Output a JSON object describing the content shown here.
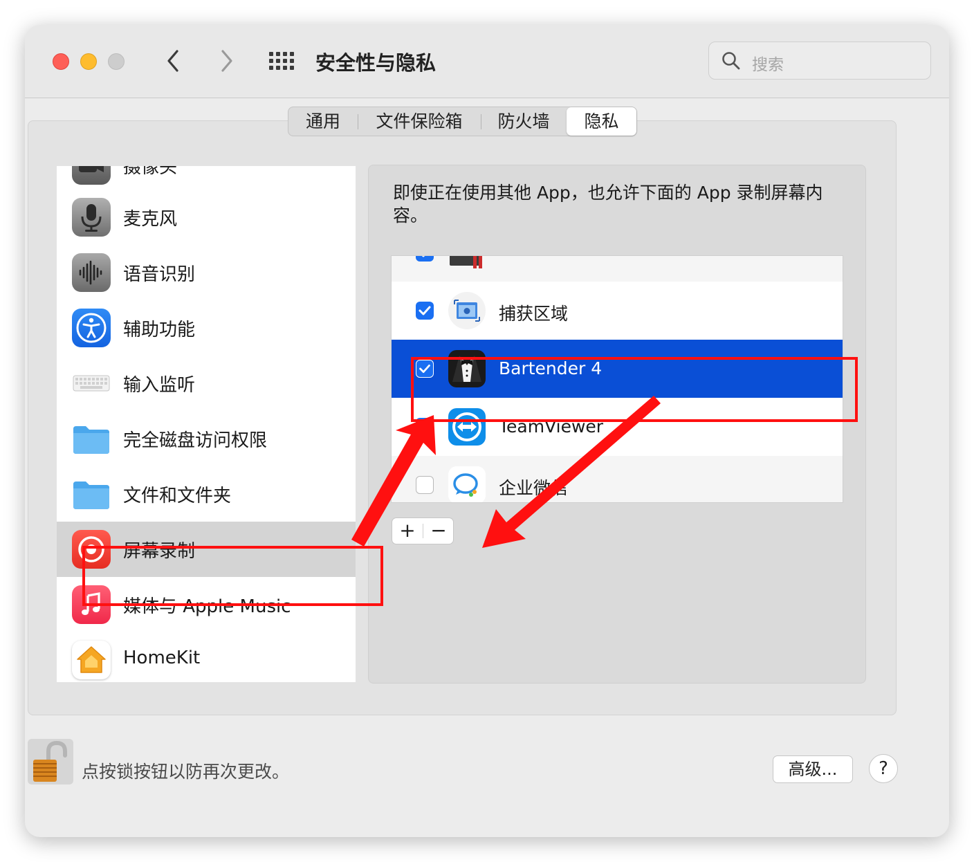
{
  "window": {
    "title": "安全性与隐私",
    "search_placeholder": "搜索"
  },
  "tabs": [
    {
      "label": "通用",
      "active": false
    },
    {
      "label": "文件保险箱",
      "active": false
    },
    {
      "label": "防火墙",
      "active": false
    },
    {
      "label": "隐私",
      "active": true
    }
  ],
  "sidebar": {
    "items": [
      {
        "label": "摄像头",
        "icon": "camera-icon"
      },
      {
        "label": "麦克风",
        "icon": "microphone-icon"
      },
      {
        "label": "语音识别",
        "icon": "speech-recognition-icon"
      },
      {
        "label": "辅助功能",
        "icon": "accessibility-icon"
      },
      {
        "label": "输入监听",
        "icon": "keyboard-icon"
      },
      {
        "label": "完全磁盘访问权限",
        "icon": "folder-icon"
      },
      {
        "label": "文件和文件夹",
        "icon": "folder-icon"
      },
      {
        "label": "屏幕录制",
        "icon": "screen-recording-icon",
        "selected": true
      },
      {
        "label": "媒体与 Apple Music",
        "icon": "music-icon"
      },
      {
        "label": "HomeKit",
        "icon": "home-icon"
      }
    ]
  },
  "main": {
    "description": "即使正在使用其他 App，也允许下面的 App 录制屏幕内容。",
    "apps": [
      {
        "label": "",
        "checked": true,
        "icon": "display-app-icon"
      },
      {
        "label": "捕获区域",
        "checked": true,
        "icon": "screenshot-icon"
      },
      {
        "label": "Bartender 4",
        "checked": true,
        "icon": "bartender-icon",
        "selected": true
      },
      {
        "label": "TeamViewer",
        "checked": true,
        "icon": "teamviewer-icon"
      },
      {
        "label": "企业微信",
        "checked": false,
        "icon": "wecom-icon"
      }
    ],
    "add_label": "+",
    "remove_label": "−"
  },
  "footer": {
    "lock_text": "点按锁按钮以防再次更改。",
    "advanced_label": "高级...",
    "help_label": "?"
  },
  "colors": {
    "accent": "#1a6ff2",
    "selection": "#0a4fd6",
    "annotation_red": "#ff1010"
  }
}
